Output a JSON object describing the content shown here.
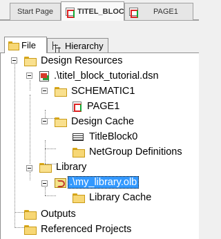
{
  "doc_tabs": [
    {
      "label": "Start Page",
      "active": false
    },
    {
      "label": "TITEL_BLOCK...",
      "active": true,
      "closable": true
    },
    {
      "label": "PAGE1",
      "active": false
    }
  ],
  "panel_tabs": [
    {
      "label": "File",
      "active": true,
      "icon": "folder-icon"
    },
    {
      "label": "Hierarchy",
      "active": false,
      "icon": "hierarchy-icon"
    }
  ],
  "tree": {
    "design_resources": "Design Resources",
    "dsn_file": ".\\titel_block_tutorial.dsn",
    "schematic": "SCHEMATIC1",
    "page": "PAGE1",
    "design_cache": "Design Cache",
    "title_block": "TitleBlock0",
    "netgroup": "NetGroup Definitions",
    "library": "Library",
    "library_file": ".\\my_library.olb",
    "library_cache": "Library Cache",
    "outputs": "Outputs",
    "referenced_projects": "Referenced Projects"
  },
  "colors": {
    "selection": "#3399ff",
    "folder": "#f7d775"
  }
}
